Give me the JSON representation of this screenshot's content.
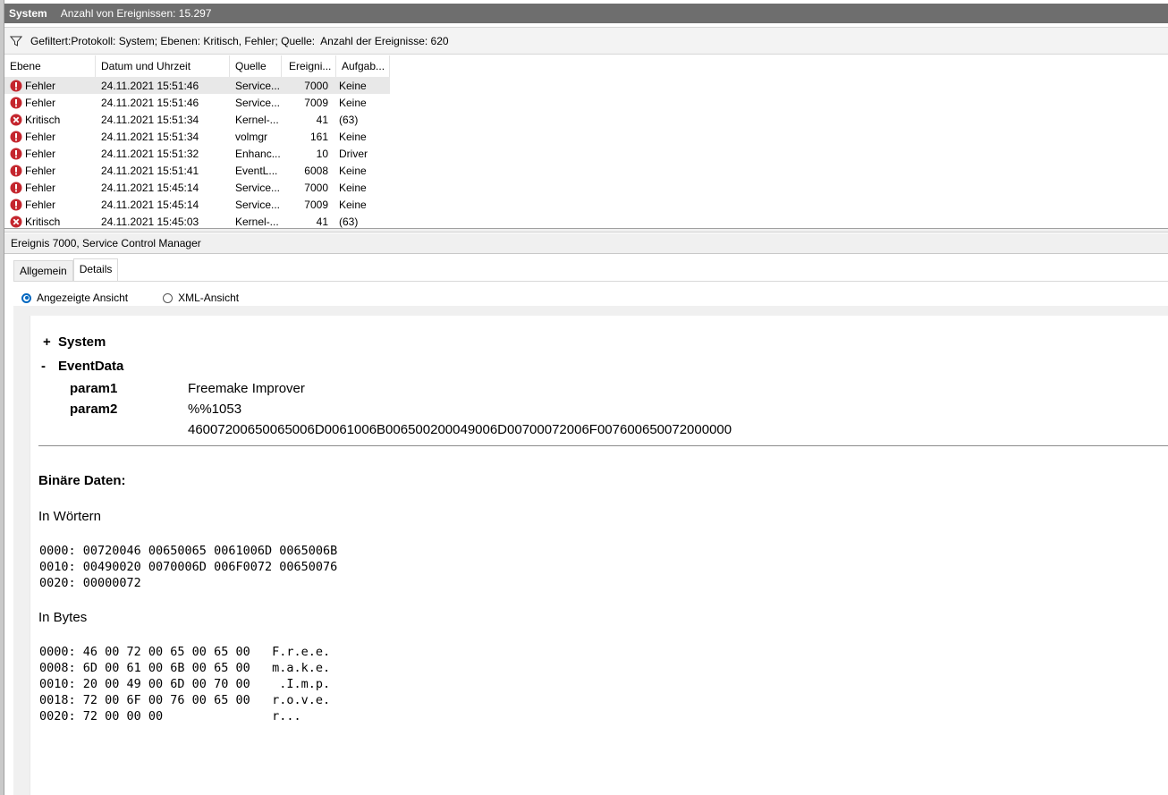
{
  "title": {
    "name": "System",
    "count_label": "Anzahl von Ereignissen: 15.297"
  },
  "filter": {
    "text": "Gefiltert:Protokoll: System; Ebenen: Kritisch, Fehler; Quelle:",
    "count": "Anzahl der Ereignisse: 620"
  },
  "table": {
    "columns": [
      "Ebene",
      "Datum und Uhrzeit",
      "Quelle",
      "Ereigni...",
      "Aufgab..."
    ],
    "rows": [
      {
        "level": "Fehler",
        "type": "error",
        "date": "24.11.2021 15:51:46",
        "source": "Service...",
        "id": "7000",
        "task": "Keine"
      },
      {
        "level": "Fehler",
        "type": "error",
        "date": "24.11.2021 15:51:46",
        "source": "Service...",
        "id": "7009",
        "task": "Keine"
      },
      {
        "level": "Kritisch",
        "type": "critical",
        "date": "24.11.2021 15:51:34",
        "source": "Kernel-...",
        "id": "41",
        "task": "(63)"
      },
      {
        "level": "Fehler",
        "type": "error",
        "date": "24.11.2021 15:51:34",
        "source": "volmgr",
        "id": "161",
        "task": "Keine"
      },
      {
        "level": "Fehler",
        "type": "error",
        "date": "24.11.2021 15:51:32",
        "source": "Enhanc...",
        "id": "10",
        "task": "Driver"
      },
      {
        "level": "Fehler",
        "type": "error",
        "date": "24.11.2021 15:51:41",
        "source": "EventL...",
        "id": "6008",
        "task": "Keine"
      },
      {
        "level": "Fehler",
        "type": "error",
        "date": "24.11.2021 15:45:14",
        "source": "Service...",
        "id": "7000",
        "task": "Keine"
      },
      {
        "level": "Fehler",
        "type": "error",
        "date": "24.11.2021 15:45:14",
        "source": "Service...",
        "id": "7009",
        "task": "Keine"
      },
      {
        "level": "Kritisch",
        "type": "critical",
        "date": "24.11.2021 15:45:03",
        "source": "Kernel-...",
        "id": "41",
        "task": "(63)"
      }
    ]
  },
  "detail": {
    "header": "Ereignis 7000, Service Control Manager",
    "tabs": [
      "Allgemein",
      "Details"
    ],
    "radio_friendly": "Angezeigte Ansicht",
    "radio_xml": "XML-Ansicht",
    "tree": {
      "system_toggle": "+",
      "system_label": "System",
      "eventdata_toggle": "-",
      "eventdata_label": "EventData",
      "param1_name": "param1",
      "param1_value": "Freemake Improver",
      "param2_name": "param2",
      "param2_value_line1": "%%1053",
      "param2_value_line2": "4600720065006500 6D0061006B006500 200049006D007000 72006F0076006500 72000000"
    },
    "binary": {
      "title": "Binäre Daten:",
      "words_label": "In Wörtern",
      "words": "0000: 00720046 00650065 0061006D 0065006B\n0010: 00490020 0070006D 006F0072 00650076\n0020: 00000072",
      "bytes_label": "In Bytes",
      "bytes": "0000: 46 00 72 00 65 00 65 00   F.r.e.e.\n0008: 6D 00 61 00 6B 00 65 00   m.a.k.e.\n0010: 20 00 49 00 6D 00 70 00    .I.m.p.\n0018: 72 00 6F 00 76 00 65 00   r.o.v.e.\n0020: 72 00 00 00               r..."
    }
  }
}
